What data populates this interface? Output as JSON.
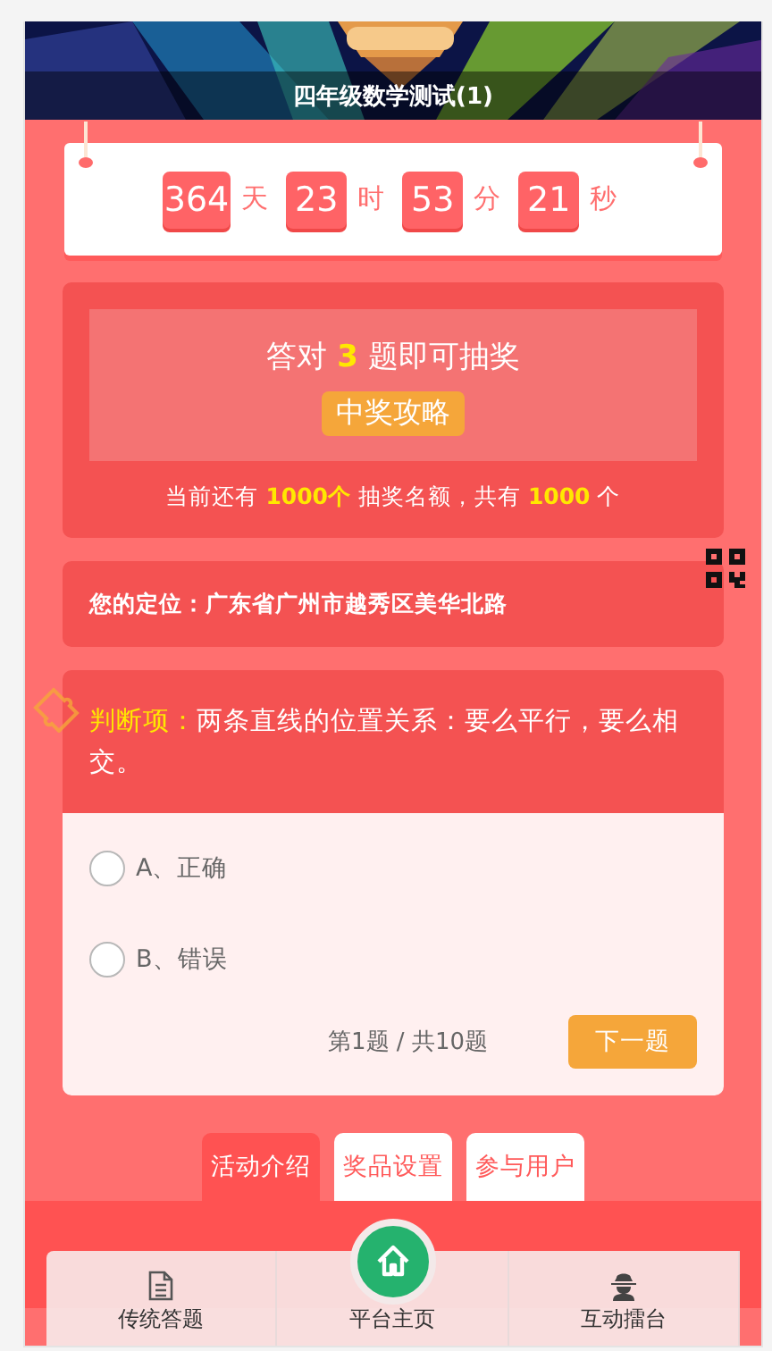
{
  "header": {
    "title": "四年级数学测试(1)"
  },
  "countdown": [
    {
      "value": "364",
      "unit": "天"
    },
    {
      "value": "23",
      "unit": "时"
    },
    {
      "value": "53",
      "unit": "分"
    },
    {
      "value": "21",
      "unit": "秒"
    }
  ],
  "prize": {
    "headline": "答对 **3** 题即可抽奖",
    "guide_button": "中奖攻略",
    "quota": "当前还有 **1000个** 抽奖名额，共有 **1000** 个"
  },
  "location": "您的定位：广东省广州市越秀区美华北路",
  "question": {
    "label": "判断项：",
    "text": "两条直线的位置关系：要么平行，要么相交。",
    "options": [
      {
        "label": "A、正确",
        "selected": false
      },
      {
        "label": "B、错误",
        "selected": false
      }
    ],
    "progress": "第1题 / 共10题",
    "next_button": "下一题"
  },
  "tabs": [
    {
      "label": "活动介绍",
      "selected": true
    },
    {
      "label": "奖品设置",
      "selected": false
    },
    {
      "label": "参与用户",
      "selected": false
    }
  ],
  "bottom_nav": [
    {
      "label": "传统答题"
    },
    {
      "label": "平台主页"
    },
    {
      "label": "互动擂台"
    }
  ]
}
